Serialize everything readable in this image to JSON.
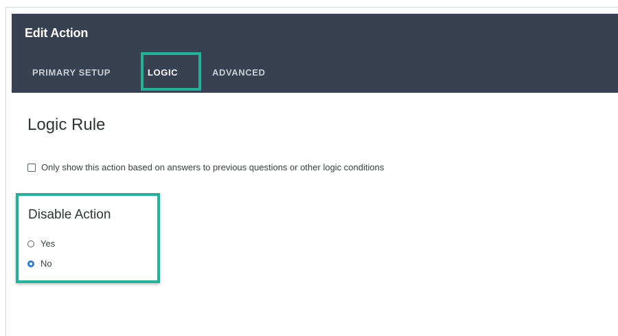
{
  "dialog": {
    "title": "Edit Action"
  },
  "tabs": [
    {
      "label": "PRIMARY SETUP",
      "active": false
    },
    {
      "label": "LOGIC",
      "active": true
    },
    {
      "label": "ADVANCED",
      "active": false
    }
  ],
  "logic": {
    "section_title": "Logic Rule",
    "checkbox_label": "Only show this action based on answers to previous questions or other logic conditions",
    "checkbox_checked": false
  },
  "disable_action": {
    "title": "Disable Action",
    "options": [
      {
        "label": "Yes",
        "checked": false
      },
      {
        "label": "No",
        "checked": true
      }
    ]
  },
  "colors": {
    "header_bg": "#384151",
    "highlight": "#20b29a",
    "radio_selected": "#2a7ae4"
  }
}
